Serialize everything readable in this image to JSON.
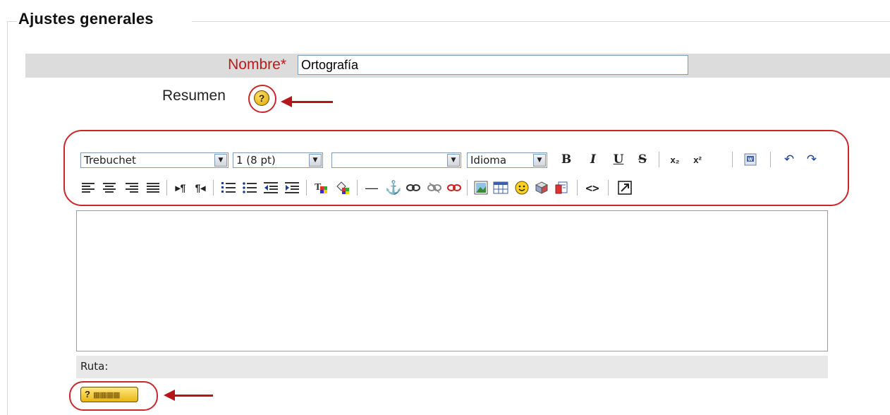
{
  "section": {
    "legend": "Ajustes generales"
  },
  "name_field": {
    "label": "Nombre",
    "required_mark": "*",
    "value": "Ortografía"
  },
  "summary": {
    "label": "Resumen",
    "help_glyph": "?"
  },
  "toolbar": {
    "font_family": "Trebuchet",
    "font_size": "1 (8 pt)",
    "format": "",
    "language": "Idioma",
    "bold": "B",
    "italic": "I",
    "underline": "U",
    "strike": "S",
    "subscript": "x₂",
    "superscript": "x²",
    "undo": "↶",
    "redo": "↷",
    "hr": "—",
    "anchor": "⚓",
    "html_source": "<>"
  },
  "editor": {
    "path_label": "Ruta:"
  },
  "help_button": {
    "glyph": "?"
  },
  "colors": {
    "accent_red": "#c8282d",
    "required_red": "#b81c1c",
    "band": "#dcdcdc"
  }
}
